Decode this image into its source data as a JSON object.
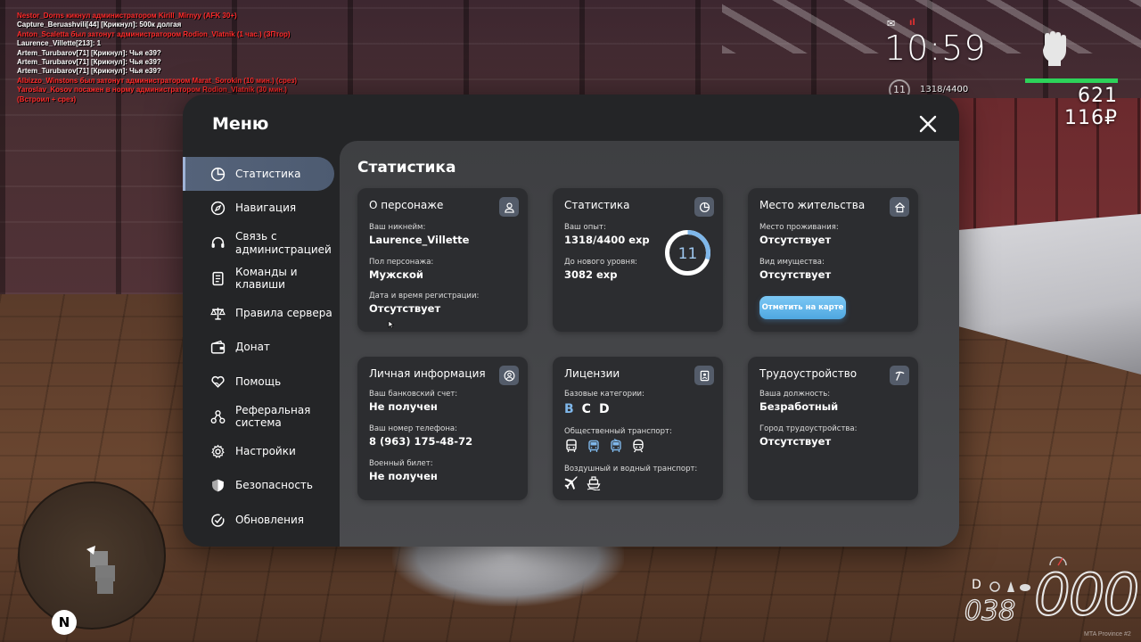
{
  "chat": [
    {
      "text": "Nestor_Dorns кикнул администратором Kirill_Mirnyy (AFK 30+)",
      "color": "red"
    },
    {
      "text": "Capture_Beruashvili[44] [Крикнул]: 500к долгая",
      "color": "white"
    },
    {
      "text": "Anton_Scaletta был затонут администратором Rodion_Vlatnik (1 час.) (ЗПтор)",
      "color": "red"
    },
    {
      "text": "Laurence_Villette[213]: 1",
      "color": "white"
    },
    {
      "text": "Artem_Turubarov[71] [Крикнул]: Чья е39?",
      "color": "white"
    },
    {
      "text": "Artem_Turubarov[71] [Крикнул]: Чья е39?",
      "color": "white"
    },
    {
      "text": "Artem_Turubarov[71] [Крикнул]: Чья е39?",
      "color": "white"
    },
    {
      "text": "Albizzo_Winstons был затонут администратором Marat_Sorokin (10 мин.) (срез)",
      "color": "red"
    },
    {
      "text": "Yaroslav_Kosov посажен в норму администратором Rodion_Vlatnik (30 мин.)",
      "color": "red"
    },
    {
      "text": "(Встроил + срез)",
      "color": "red"
    }
  ],
  "hud": {
    "time": "10:59",
    "level": "11",
    "exp": "1318/4400",
    "health_fraction": 1.0,
    "money": "621 116₽",
    "speed": "000",
    "fuel": "038",
    "gear": "D",
    "compass": "N",
    "watermark": "MTA Province #2"
  },
  "menu": {
    "title": "Меню",
    "sidebar": [
      {
        "label": "Статистика",
        "icon": "pie-chart-icon",
        "active": true
      },
      {
        "label": "Навигация",
        "icon": "compass-icon"
      },
      {
        "label": "Связь с администрацией",
        "icon": "headset-icon"
      },
      {
        "label": "Команды и клавиши",
        "icon": "document-icon"
      },
      {
        "label": "Правила сервера",
        "icon": "scales-icon"
      },
      {
        "label": "Донат",
        "icon": "wallet-icon"
      },
      {
        "label": "Помощь",
        "icon": "heart-hand-icon"
      },
      {
        "label": "Реферальная система",
        "icon": "network-icon"
      },
      {
        "label": "Настройки",
        "icon": "gear-icon"
      },
      {
        "label": "Безопасность",
        "icon": "shield-icon"
      },
      {
        "label": "Обновления",
        "icon": "check-circle-icon"
      }
    ],
    "content_title": "Статистика",
    "cards": {
      "character": {
        "title": "О персонаже",
        "nick_label": "Ваш никнейм:",
        "nick_value": "Laurence_Villette",
        "gender_label": "Пол персонажа:",
        "gender_value": "Мужской",
        "reg_label": "Дата и время регистрации:",
        "reg_value": "Отсутствует"
      },
      "stats": {
        "title": "Статистика",
        "exp_label": "Ваш опыт:",
        "exp_value": "1318/4400 exp",
        "next_label": "До нового уровня:",
        "next_value": "3082 exp",
        "level": "11",
        "progress": 0.3
      },
      "residence": {
        "title": "Место жительства",
        "place_label": "Место проживания:",
        "place_value": "Отсутствует",
        "property_label": "Вид имущества:",
        "property_value": "Отсутствует",
        "button": "Отметить на карте"
      },
      "personal": {
        "title": "Личная информация",
        "bank_label": "Ваш банковский счет:",
        "bank_value": "Не получен",
        "phone_label": "Ваш номер телефона:",
        "phone_value": "8 (963) 175-48-72",
        "military_label": "Военный билет:",
        "military_value": "Не получен"
      },
      "licenses": {
        "title": "Лицензии",
        "base_label": "Базовые категории:",
        "categories": [
          {
            "name": "B",
            "owned": true
          },
          {
            "name": "C",
            "owned": false
          },
          {
            "name": "D",
            "owned": false
          }
        ],
        "public_label": "Общественный транспорт:",
        "air_label": "Воздушный и водный транспорт:"
      },
      "employment": {
        "title": "Трудоустройство",
        "position_label": "Ваша должность:",
        "position_value": "Безработный",
        "city_label": "Город трудоустройства:",
        "city_value": "Отсутствует"
      }
    }
  },
  "colors": {
    "accent": "#7fb7ea",
    "active_item": "#55637a",
    "panel": "#242527",
    "card": "#2c2d30",
    "chat_red": "#ff2a2a",
    "health": "#2dd35a"
  }
}
